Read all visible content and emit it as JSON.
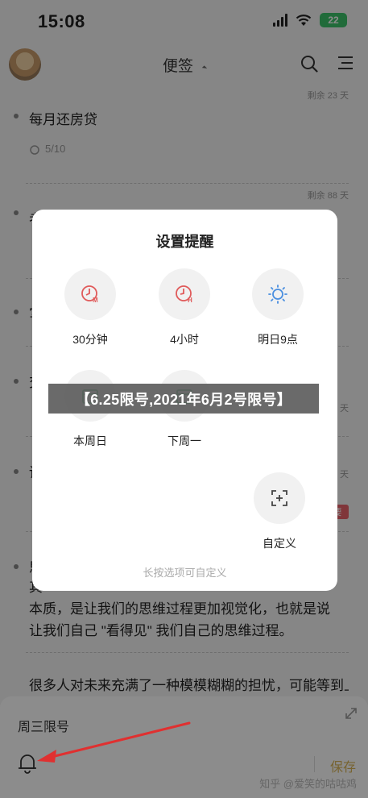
{
  "status": {
    "time": "15:08",
    "battery": "22"
  },
  "nav": {
    "title": "便签"
  },
  "notes": [
    {
      "remain": "剩余 23 天",
      "title": "每月还房贷",
      "meta": "5/10"
    },
    {
      "remain": "剩余 88 天",
      "title": "考试内容"
    },
    {
      "remain": "",
      "title": "写"
    },
    {
      "remain": "剩余 86 天",
      "title": "交"
    },
    {
      "remain": "剩余 85 天",
      "title": "读",
      "tag": "要"
    },
    {
      "title": "思",
      "lines": [
        "其",
        "本质，是让我们的思维过程更加视觉化，也就是说",
        "让我们自己 \"看得见\" 我们自己的思维过程。"
      ]
    },
    {
      "title": "很多人对未来充满了一种模模糊糊的担忧，可能等到上"
    }
  ],
  "dialog": {
    "title": "设置提醒",
    "options": [
      {
        "label": "30分钟",
        "icon": "clock-m-icon"
      },
      {
        "label": "4小时",
        "icon": "clock-h-icon"
      },
      {
        "label": "明日9点",
        "icon": "sun-icon"
      },
      {
        "label": "本周日",
        "icon": "calendar-icon"
      },
      {
        "label": "下周一",
        "icon": "calendar-icon"
      },
      {
        "label": "自定义",
        "icon": "custom-add-icon"
      }
    ],
    "hint": "长按选项可自定义"
  },
  "banner": "【6.25限号,2021年6月2号限号】",
  "sheet": {
    "text": "周三限号",
    "save": "保存"
  },
  "watermark": "知乎 @爱笑的咕咕鸡",
  "colors": {
    "accent_red": "#e05a5a",
    "save_gold": "#d9b458",
    "sun_blue": "#4a8fe0"
  }
}
